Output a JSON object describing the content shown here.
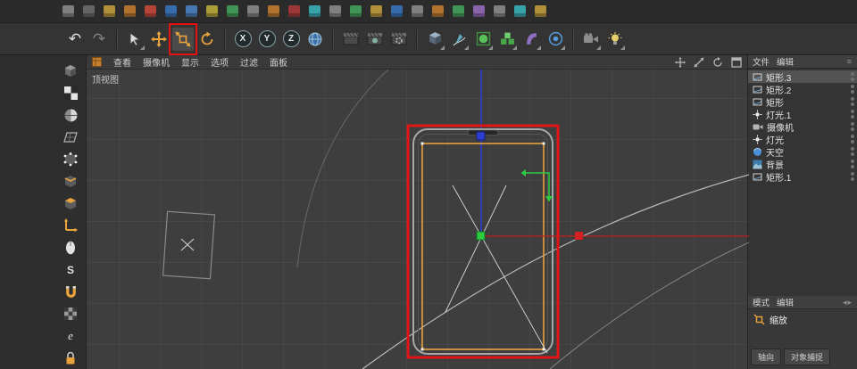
{
  "colors": {
    "accent_orange": "#e8a33d",
    "annotation_red": "#e01515",
    "axis_x_red": "#c92a2a",
    "axis_vertical_blue": "#2b3fd4",
    "gizmo_center_green": "#2ecc40",
    "selected_spline_orange": "#e8a33d",
    "viewport_background": "#3e3e3e"
  },
  "menu_row": {
    "icon_colors": [
      "#8f8f8f",
      "#6f6f6f",
      "#caa23e",
      "#c87f2e",
      "#cf4a3c",
      "#3b77c2",
      "#4d86c9",
      "#c2b23b",
      "#44a85e",
      "#8f8f8f",
      "#c87f2e",
      "#b03b3b",
      "#3bb7c2",
      "#8f8f8f",
      "#44a85e",
      "#caa23e",
      "#3b77c2",
      "#8f8f8f",
      "#c87f2e",
      "#44a85e",
      "#9a6fc2",
      "#8f8f8f",
      "#3bb7c2",
      "#caa23e"
    ]
  },
  "toolbar": {
    "axis_buttons": [
      "X",
      "Y",
      "Z"
    ],
    "icons": [
      "undo",
      "redo",
      "selection-tool",
      "move-tool",
      "scale-tool",
      "rotate-tool",
      "lock-x-axis",
      "lock-y-axis",
      "lock-z-axis",
      "coordinate-system",
      "render-view",
      "render-to-picture-viewer",
      "edit-render-settings",
      "add-cube",
      "pen-spline",
      "subdivision-surface",
      "array-generator",
      "deformer",
      "camera",
      "light"
    ],
    "active_tool": "scale-tool"
  },
  "left_toolbar": {
    "icons": [
      "make-editable",
      "model-mode",
      "texture-mode",
      "workplane-mode",
      "points-mode",
      "edges-mode",
      "polygons-mode",
      "enable-axis",
      "viewport-solo",
      "snap",
      "magnet",
      "texture",
      "enhanced-mode",
      "lock-axis"
    ]
  },
  "viewport": {
    "menu": [
      "查看",
      "摄像机",
      "显示",
      "选项",
      "过滤",
      "面板"
    ],
    "view_label": "顶视图",
    "nav_icons": [
      "pan",
      "zoom",
      "rotate",
      "maximize"
    ]
  },
  "object_manager": {
    "menu": [
      "文件",
      "编辑"
    ],
    "items": [
      {
        "label": "矩形.3",
        "icon": "spline-rectangle",
        "selected": true
      },
      {
        "label": "矩形.2",
        "icon": "spline-rectangle",
        "selected": false
      },
      {
        "label": "矩形",
        "icon": "spline-rectangle",
        "selected": false
      },
      {
        "label": "灯光.1",
        "icon": "light",
        "selected": false
      },
      {
        "label": "摄像机",
        "icon": "camera",
        "selected": false
      },
      {
        "label": "灯光",
        "icon": "light",
        "selected": false
      },
      {
        "label": "天空",
        "icon": "sky",
        "selected": false
      },
      {
        "label": "背景",
        "icon": "background",
        "selected": false
      },
      {
        "label": "矩形.1",
        "icon": "spline-rectangle",
        "selected": false
      }
    ]
  },
  "attribute_manager": {
    "menu": [
      "模式",
      "编辑"
    ],
    "tool_label": "缩放",
    "tabs": [
      "轴向",
      "对象捕捉"
    ]
  }
}
